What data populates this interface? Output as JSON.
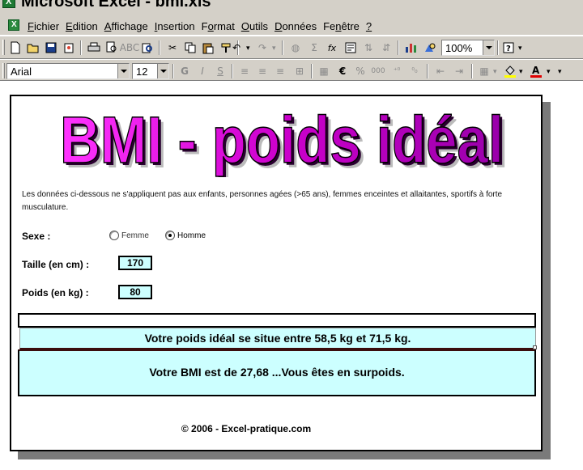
{
  "window": {
    "title": "Microsoft Excel - bmi.xls"
  },
  "menubar": {
    "items": [
      {
        "accel": "F",
        "rest": "ichier"
      },
      {
        "accel": "E",
        "rest": "dition"
      },
      {
        "accel": "A",
        "rest": "ffichage"
      },
      {
        "accel": "I",
        "rest": "nsertion"
      },
      {
        "pre": "F",
        "accel": "o",
        "rest": "rmat"
      },
      {
        "accel": "O",
        "rest": "utils"
      },
      {
        "accel": "D",
        "rest": "onnées"
      },
      {
        "pre": "Fe",
        "accel": "n",
        "rest": "être"
      },
      {
        "accel": "?",
        "rest": ""
      }
    ]
  },
  "toolbar": {
    "zoom_value": "100%",
    "font_name": "Arial",
    "font_size": "12"
  },
  "sheet": {
    "banner_text": "BMI - poids idéal",
    "intro_text": "Les données ci-dessous ne s'appliquent pas aux enfants, personnes agées (>65 ans), femmes enceintes et allaitantes, sportifs à forte musculature.",
    "sex_label": "Sexe :",
    "option_female": "Femme",
    "option_male": "Homme",
    "selected_sex": "Homme",
    "height_label": "Taille (en cm) :",
    "height_value": "170",
    "weight_label": "Poids (en kg) :",
    "weight_value": "80",
    "result_ideal": "Votre poids idéal se situe entre 58,5 kg et 71,5 kg.",
    "result_bmi": "Votre BMI est de 27,68 ...Vous êtes en surpoids.",
    "copyright": "© 2006 - Excel-pratique.com"
  },
  "colors": {
    "input_fill": "#ccffff",
    "banner_magenta": "#cc00cc",
    "chrome": "#d4d0c8"
  }
}
